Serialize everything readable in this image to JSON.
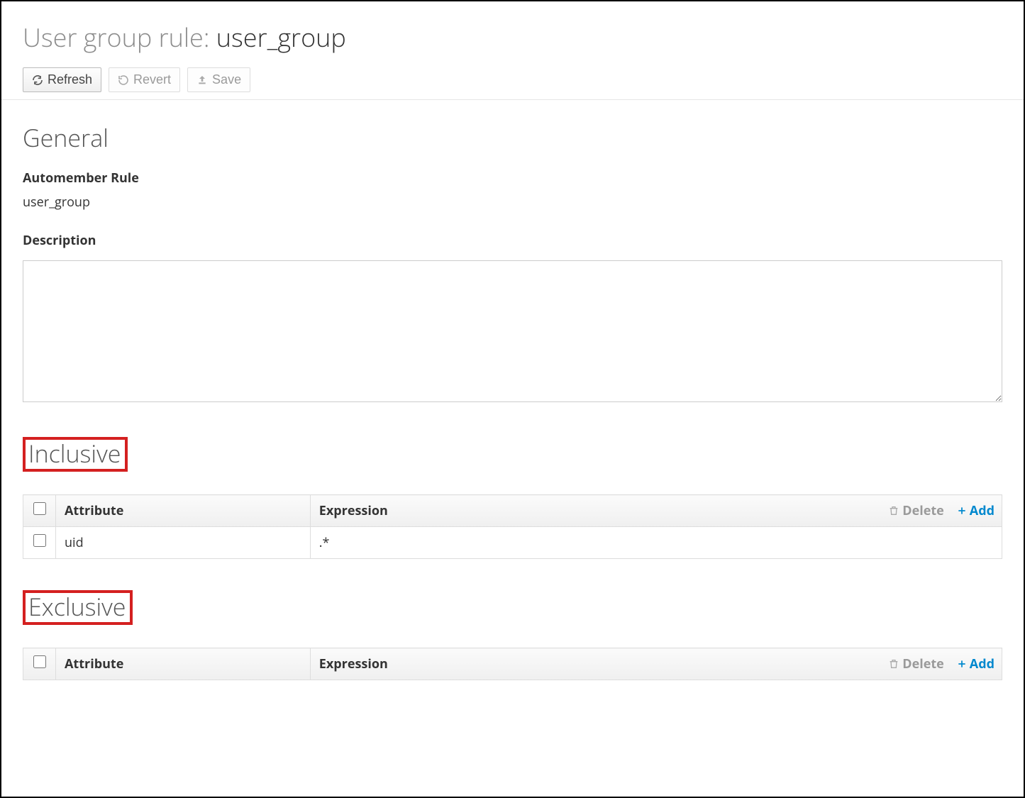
{
  "title": {
    "prefix": "User group rule: ",
    "name": "user_group"
  },
  "toolbar": {
    "refresh": "Refresh",
    "revert": "Revert",
    "save": "Save"
  },
  "general": {
    "heading": "General",
    "rule_label": "Automember Rule",
    "rule_value": "user_group",
    "desc_label": "Description",
    "desc_value": ""
  },
  "tables": {
    "col_attribute": "Attribute",
    "col_expression": "Expression",
    "delete": "Delete",
    "add": "Add"
  },
  "inclusive": {
    "heading": "Inclusive",
    "rows": [
      {
        "attribute": "uid",
        "expression": ".*"
      }
    ]
  },
  "exclusive": {
    "heading": "Exclusive",
    "rows": []
  }
}
